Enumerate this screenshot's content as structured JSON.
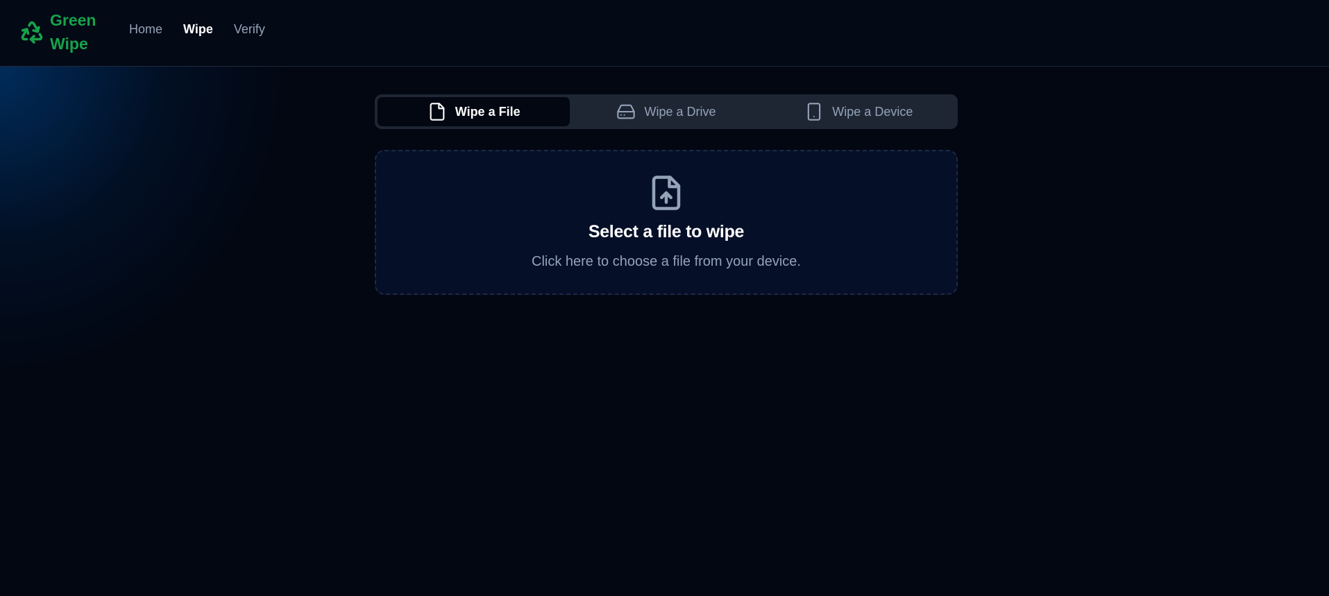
{
  "app": {
    "brand": "Green Wipe",
    "brand_color": "#16a34a",
    "logo_icon": "recycle-icon"
  },
  "nav": {
    "items": [
      {
        "label": "Home",
        "active": false
      },
      {
        "label": "Wipe",
        "active": true
      },
      {
        "label": "Verify",
        "active": false
      }
    ]
  },
  "tabs": [
    {
      "label": "Wipe a File",
      "icon": "file-icon",
      "active": true
    },
    {
      "label": "Wipe a Drive",
      "icon": "hard-drive-icon",
      "active": false
    },
    {
      "label": "Wipe a Device",
      "icon": "smartphone-icon",
      "active": false
    }
  ],
  "dropzone": {
    "icon": "file-upload-icon",
    "title": "Select a file to wipe",
    "subtitle": "Click here to choose a file from your device."
  }
}
